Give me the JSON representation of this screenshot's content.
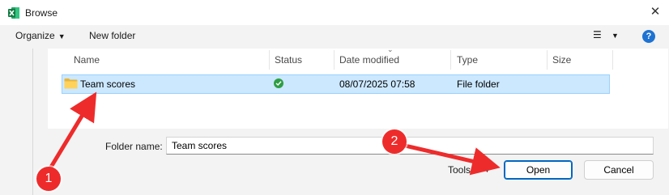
{
  "window": {
    "title": "Browse",
    "close_glyph": "✕",
    "app_icon": "excel-icon"
  },
  "toolbar": {
    "organize_label": "Organize",
    "organize_caret": "▼",
    "new_folder_label": "New folder",
    "view_glyph": "☰",
    "view_caret": "▼",
    "help_glyph": "?"
  },
  "file_list": {
    "sort_indicator": "⌄",
    "columns": [
      "Name",
      "Status",
      "Date modified",
      "Type",
      "Size"
    ],
    "rows": [
      {
        "name": "Team scores",
        "status": "synced",
        "date_modified": "08/07/2025 07:58",
        "type": "File folder",
        "size": ""
      }
    ]
  },
  "footer": {
    "folder_name_label": "Folder name:",
    "folder_name_value": "Team scores",
    "tools_label": "Tools",
    "tools_caret": "▼",
    "open_label": "Open",
    "cancel_label": "Cancel"
  },
  "annotations": {
    "badge_1": "1",
    "badge_2": "2",
    "color": "#ee2b2b"
  },
  "colors": {
    "selection_bg": "#cce8ff",
    "selection_border": "#99d1ff",
    "primary_border": "#0067c0",
    "help_blue": "#1e73d2",
    "status_green": "#2e9e44"
  }
}
